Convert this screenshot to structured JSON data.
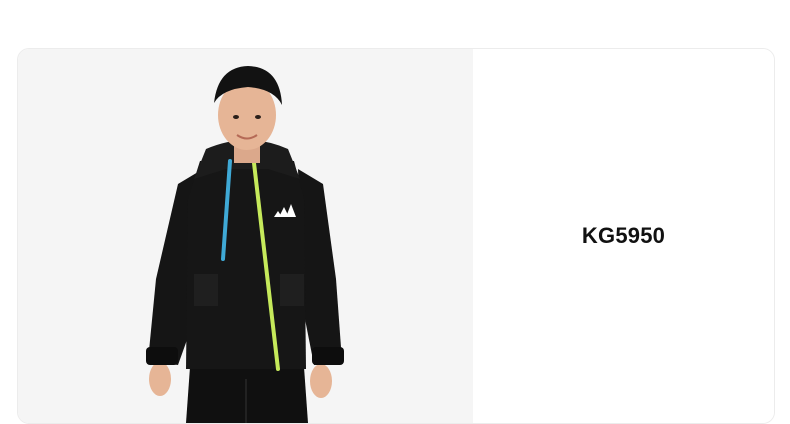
{
  "product": {
    "sku": "KG5950",
    "image_subject": "product-photo",
    "colors": {
      "jacket": "#151515",
      "zip_left": "#3fa9d6",
      "zip_right": "#c6ea5b",
      "background": "#f5f5f5"
    }
  }
}
